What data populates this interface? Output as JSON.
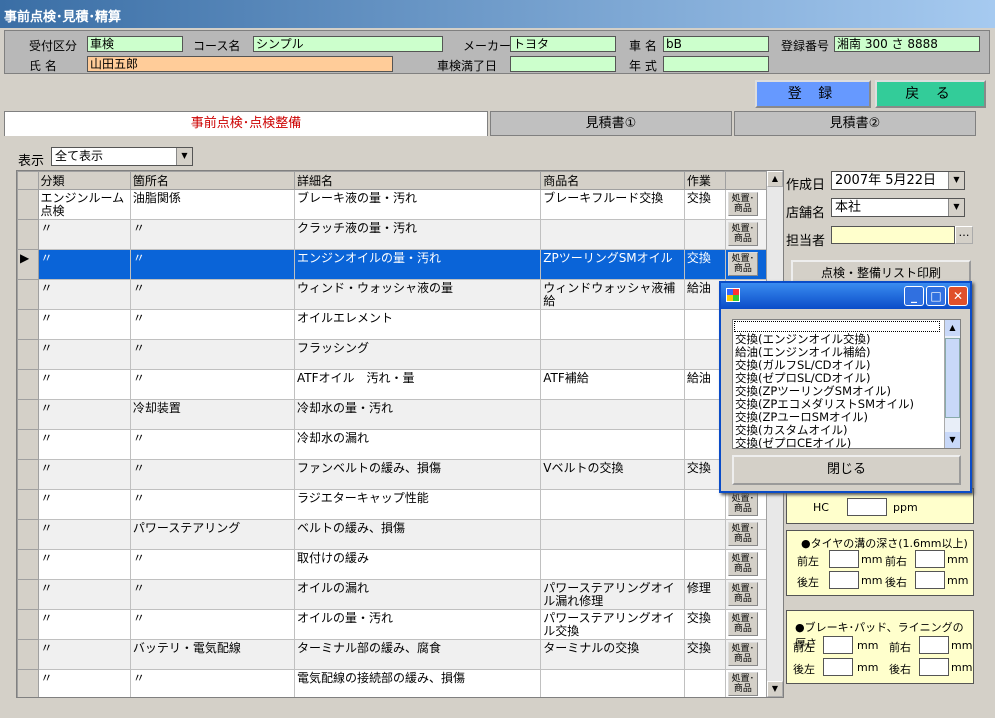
{
  "window": {
    "title": "事前点検･見積･精算"
  },
  "header": {
    "uketsuke_label": "受付区分",
    "uketsuke_value": "車検",
    "course_label": "コース名",
    "course_value": "シンプル",
    "maker_label": "メーカー",
    "maker_value": "トヨタ",
    "car_label": "車 名",
    "car_value": "bB",
    "reg_label": "登録番号",
    "reg_value": "湘南 300 さ 8888",
    "name_label": "氏 名",
    "name_value": "山田五郎",
    "expiry_label": "車検満了日",
    "expiry_value": "",
    "year_label": "年 式",
    "year_value": ""
  },
  "buttons": {
    "register": "登 録",
    "back": "戻 る"
  },
  "tabs": [
    "事前点検･点検整備",
    "見積書①",
    "見積書②"
  ],
  "filter": {
    "label": "表示",
    "value": "全て表示"
  },
  "columns": [
    "分類",
    "箇所名",
    "詳細名",
    "商品名",
    "作業"
  ],
  "mini_label_top": "処置･",
  "mini_label_bottom": "商品",
  "rows": [
    {
      "c1": "エンジンルーム点検",
      "c2": "油脂関係",
      "c3": "ブレーキ液の量・汚れ",
      "c4": "ブレーキフルード交換",
      "c5": "交換"
    },
    {
      "c1": "〃",
      "c2": "〃",
      "c3": "クラッチ液の量・汚れ",
      "c4": "",
      "c5": ""
    },
    {
      "c1": "〃",
      "c2": "〃",
      "c3": "エンジンオイルの量・汚れ",
      "c4": "ZPツーリングSMオイル",
      "c5": "交換"
    },
    {
      "c1": "〃",
      "c2": "〃",
      "c3": "ウィンド・ウォッシャ液の量",
      "c4": "ウィンドウォッシャ液補給",
      "c5": "給油"
    },
    {
      "c1": "〃",
      "c2": "〃",
      "c3": "オイルエレメント",
      "c4": "",
      "c5": ""
    },
    {
      "c1": "〃",
      "c2": "〃",
      "c3": "フラッシング",
      "c4": "",
      "c5": ""
    },
    {
      "c1": "〃",
      "c2": "〃",
      "c3": "ATFオイル　汚れ・量",
      "c4": "ATF補給",
      "c5": "給油"
    },
    {
      "c1": "〃",
      "c2": "冷却装置",
      "c3": "冷却水の量・汚れ",
      "c4": "",
      "c5": ""
    },
    {
      "c1": "〃",
      "c2": "〃",
      "c3": "冷却水の漏れ",
      "c4": "",
      "c5": ""
    },
    {
      "c1": "〃",
      "c2": "〃",
      "c3": "ファンベルトの緩み、損傷",
      "c4": "Vベルトの交換",
      "c5": "交換"
    },
    {
      "c1": "〃",
      "c2": "〃",
      "c3": "ラジエターキャップ性能",
      "c4": "",
      "c5": ""
    },
    {
      "c1": "〃",
      "c2": "パワーステアリング",
      "c3": "ベルトの緩み、損傷",
      "c4": "",
      "c5": ""
    },
    {
      "c1": "〃",
      "c2": "〃",
      "c3": "取付けの緩み",
      "c4": "",
      "c5": ""
    },
    {
      "c1": "〃",
      "c2": "〃",
      "c3": "オイルの漏れ",
      "c4": "パワーステアリングオイル漏れ修理",
      "c5": "修理"
    },
    {
      "c1": "〃",
      "c2": "〃",
      "c3": "オイルの量・汚れ",
      "c4": "パワーステアリングオイル交換",
      "c5": "交換"
    },
    {
      "c1": "〃",
      "c2": "バッテリ・電気配線",
      "c3": "ターミナル部の緩み、腐食",
      "c4": "ターミナルの交換",
      "c5": "交換"
    },
    {
      "c1": "〃",
      "c2": "〃",
      "c3": "電気配線の接続部の緩み、損傷",
      "c4": "",
      "c5": ""
    }
  ],
  "right": {
    "date_label": "作成日",
    "date_value": "2007年 5月22日",
    "shop_label": "店舗名",
    "shop_value": "本社",
    "staff_label": "担当者",
    "staff_value": "",
    "hidden_button": "点検・整備リスト印刷",
    "hc_label": "HC",
    "hc_unit": "ppm",
    "tire_title": "●タイヤの溝の深さ(1.6mm以上)",
    "brake_title": "●ブレーキ･パッド、ライニングの厚さ",
    "fl": "前左",
    "fr": "前右",
    "rl": "後左",
    "rr": "後右",
    "mm": "mm"
  },
  "popup": {
    "items": [
      "",
      "交換(エンジンオイル交換)",
      "給油(エンジンオイル補給)",
      "交換(ガルフSL/CDオイル)",
      "交換(ゼプロSL/CDオイル)",
      "交換(ZPツーリングSMオイル)",
      "交換(ZPエコメダリストSMオイル)",
      "交換(ZPユーロSMオイル)",
      "交換(カスタムオイル)",
      "交換(ゼプロCEオイル)"
    ],
    "close_label": "閉じる"
  },
  "colors": {
    "field_green": "#ccffcc",
    "field_orange": "#ffcc99",
    "register_btn": "#6699ff",
    "back_btn": "#33cc99",
    "selected_row": "#0a64d8",
    "tab_active_text": "#cc0000"
  }
}
